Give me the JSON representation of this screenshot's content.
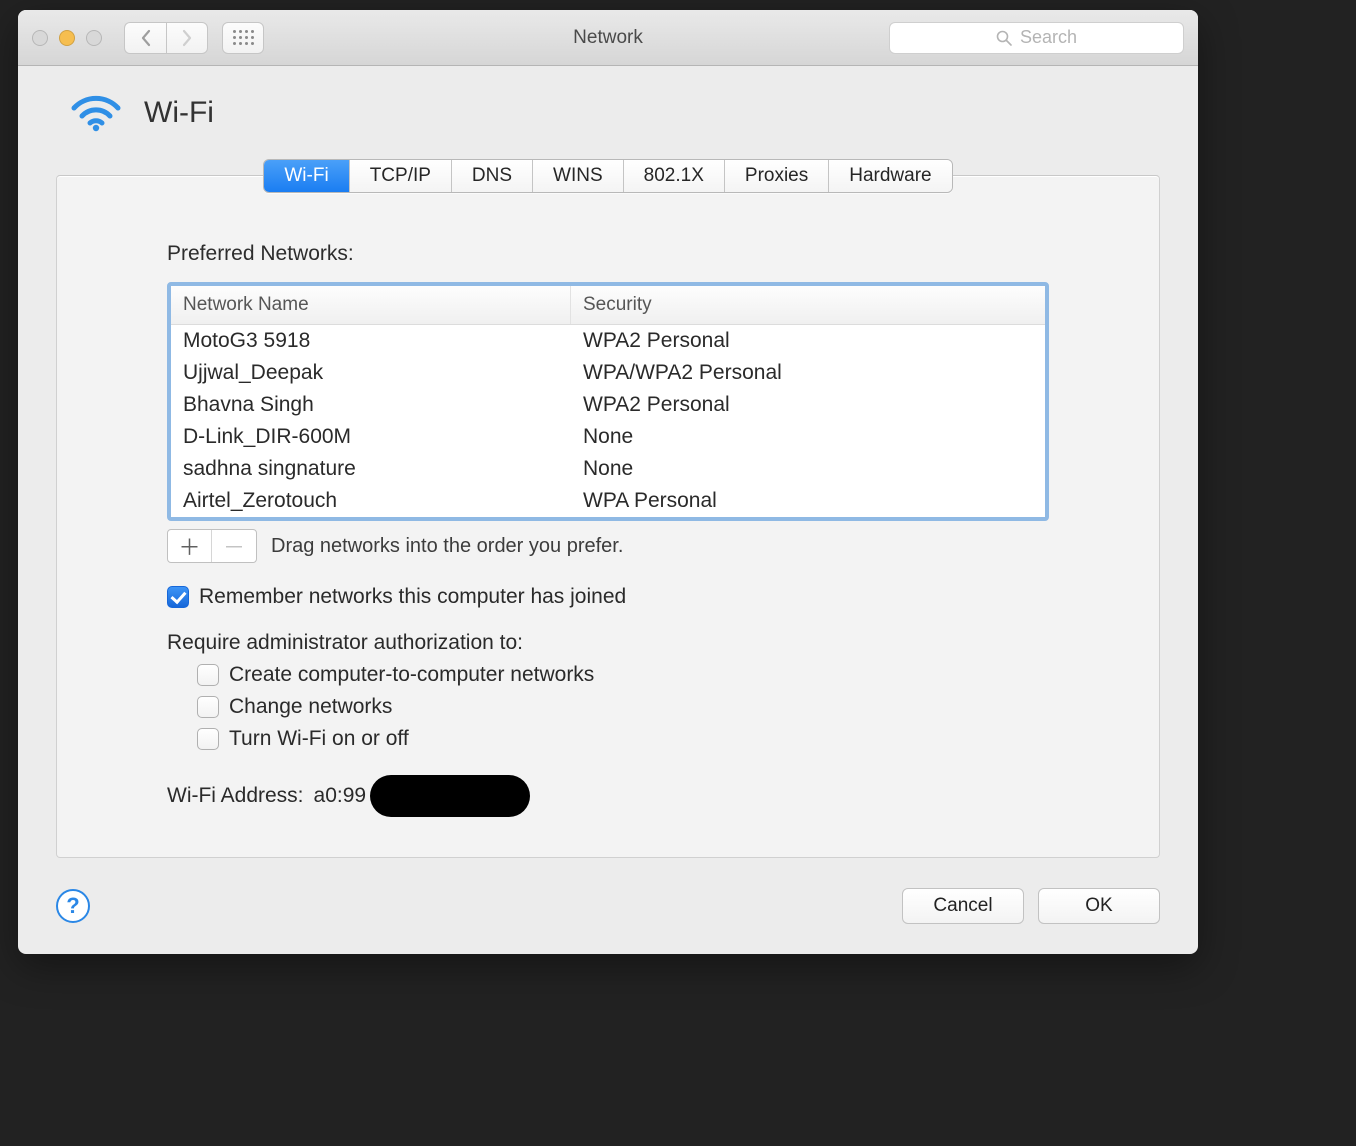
{
  "window": {
    "title": "Network",
    "search_placeholder": "Search"
  },
  "header": {
    "title": "Wi-Fi"
  },
  "tabs": [
    "Wi-Fi",
    "TCP/IP",
    "DNS",
    "WINS",
    "802.1X",
    "Proxies",
    "Hardware"
  ],
  "active_tab_index": 0,
  "section": {
    "preferred_label": "Preferred Networks:",
    "columns": {
      "name": "Network Name",
      "security": "Security"
    },
    "networks": [
      {
        "name": "MotoG3 5918",
        "security": "WPA2 Personal"
      },
      {
        "name": "Ujjwal_Deepak",
        "security": "WPA/WPA2 Personal"
      },
      {
        "name": "Bhavna Singh",
        "security": "WPA2 Personal"
      },
      {
        "name": "D-Link_DIR-600M",
        "security": "None"
      },
      {
        "name": "sadhna singnature",
        "security": "None"
      },
      {
        "name": "Airtel_Zerotouch",
        "security": "WPA Personal"
      }
    ],
    "drag_hint": "Drag networks into the order you prefer.",
    "remember_label": "Remember networks this computer has joined",
    "remember_checked": true,
    "admin_label": "Require administrator authorization to:",
    "admin_opts": [
      {
        "label": "Create computer-to-computer networks",
        "checked": false
      },
      {
        "label": "Change networks",
        "checked": false
      },
      {
        "label": "Turn Wi-Fi on or off",
        "checked": false
      }
    ],
    "address_label": "Wi-Fi Address:",
    "address_value": "a0:99"
  },
  "footer": {
    "cancel": "Cancel",
    "ok": "OK",
    "help": "?"
  }
}
